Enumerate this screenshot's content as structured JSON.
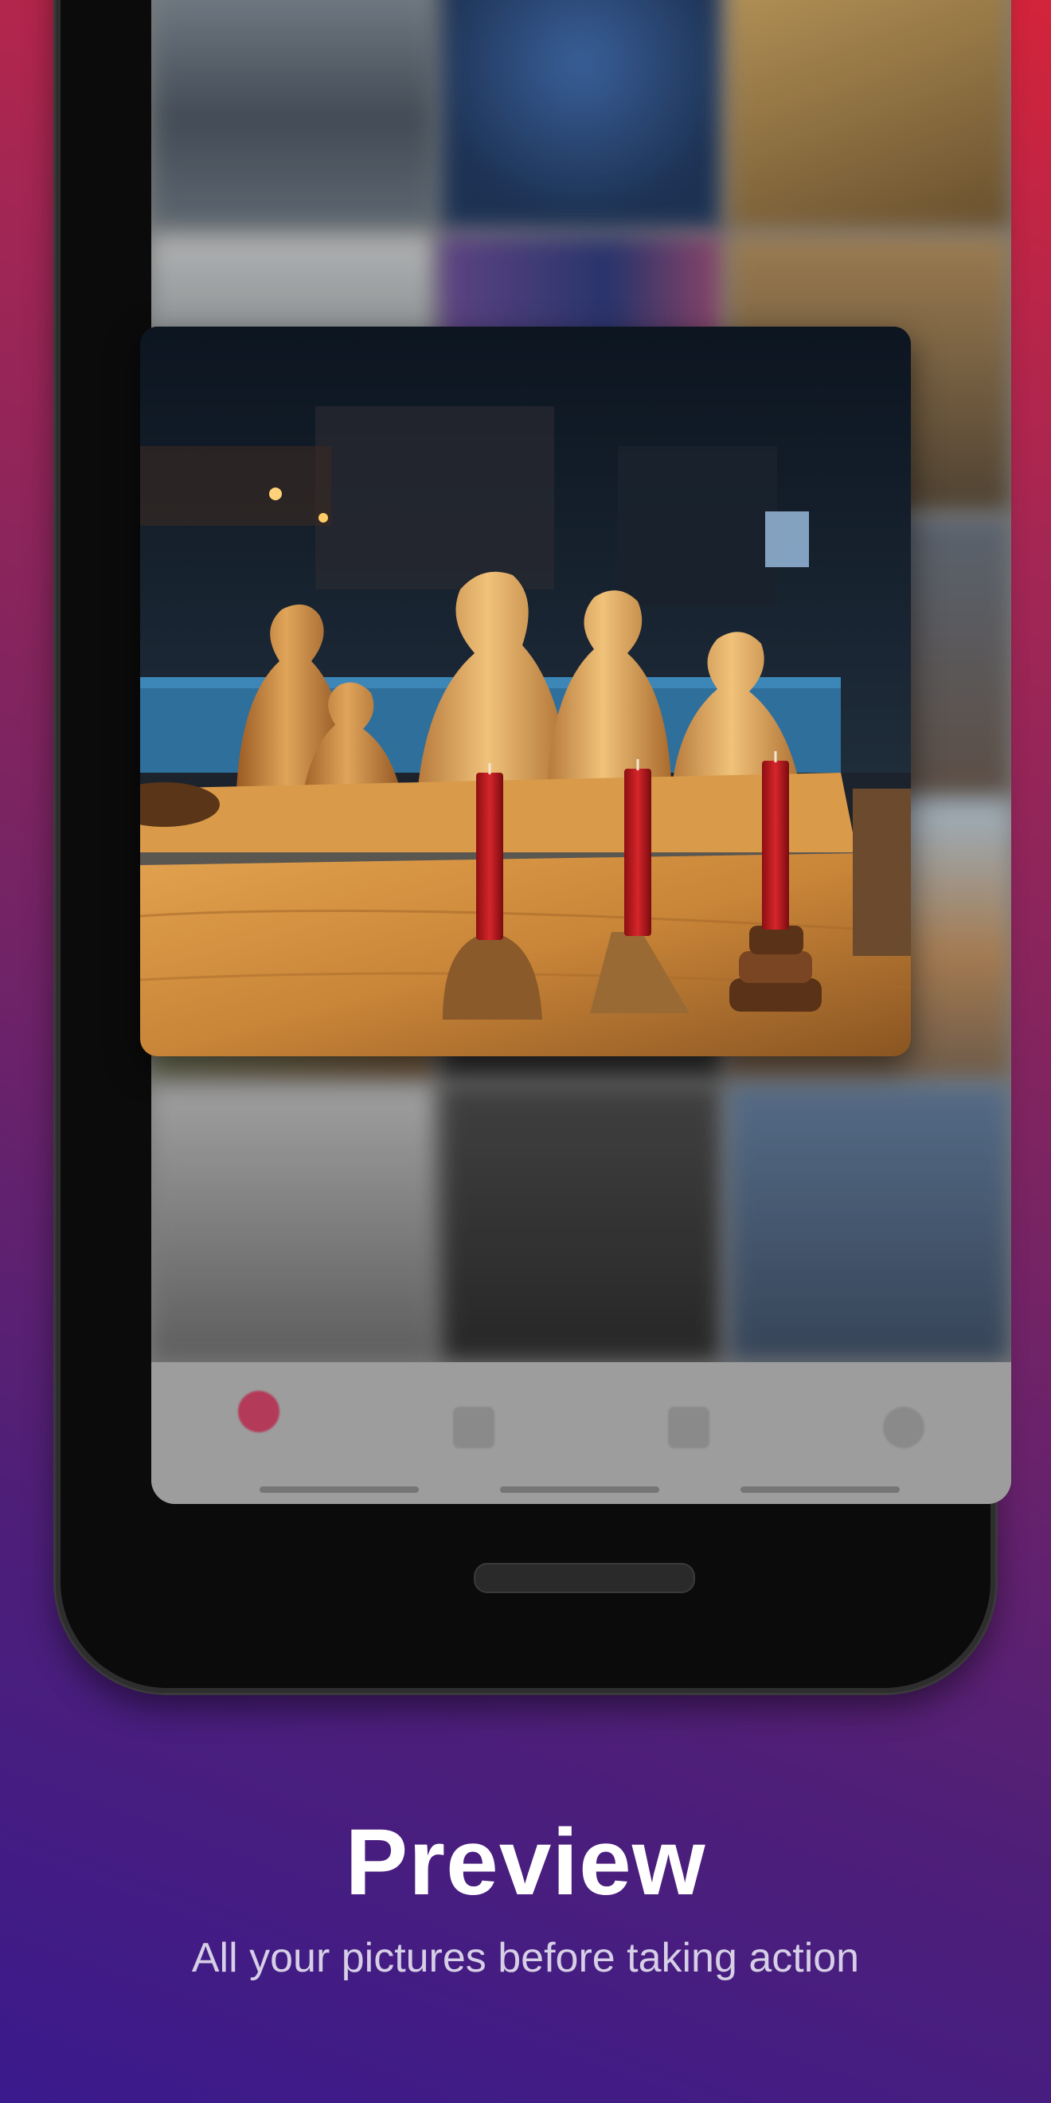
{
  "caption": {
    "title": "Preview",
    "subtitle": "All your pictures before taking action"
  },
  "colors": {
    "background_top": "#d3243a",
    "background_bottom": "#3a1a8c",
    "accent": "#b33a58"
  },
  "bottom_nav": {
    "items": [
      {
        "icon": "home-icon",
        "active": true
      },
      {
        "icon": "folder-icon",
        "active": false
      },
      {
        "icon": "tag-icon",
        "active": false
      },
      {
        "icon": "profile-icon",
        "active": false
      }
    ]
  },
  "preview_image": {
    "subject": "wooden pawn figures with red candles on a wooden shelf"
  }
}
